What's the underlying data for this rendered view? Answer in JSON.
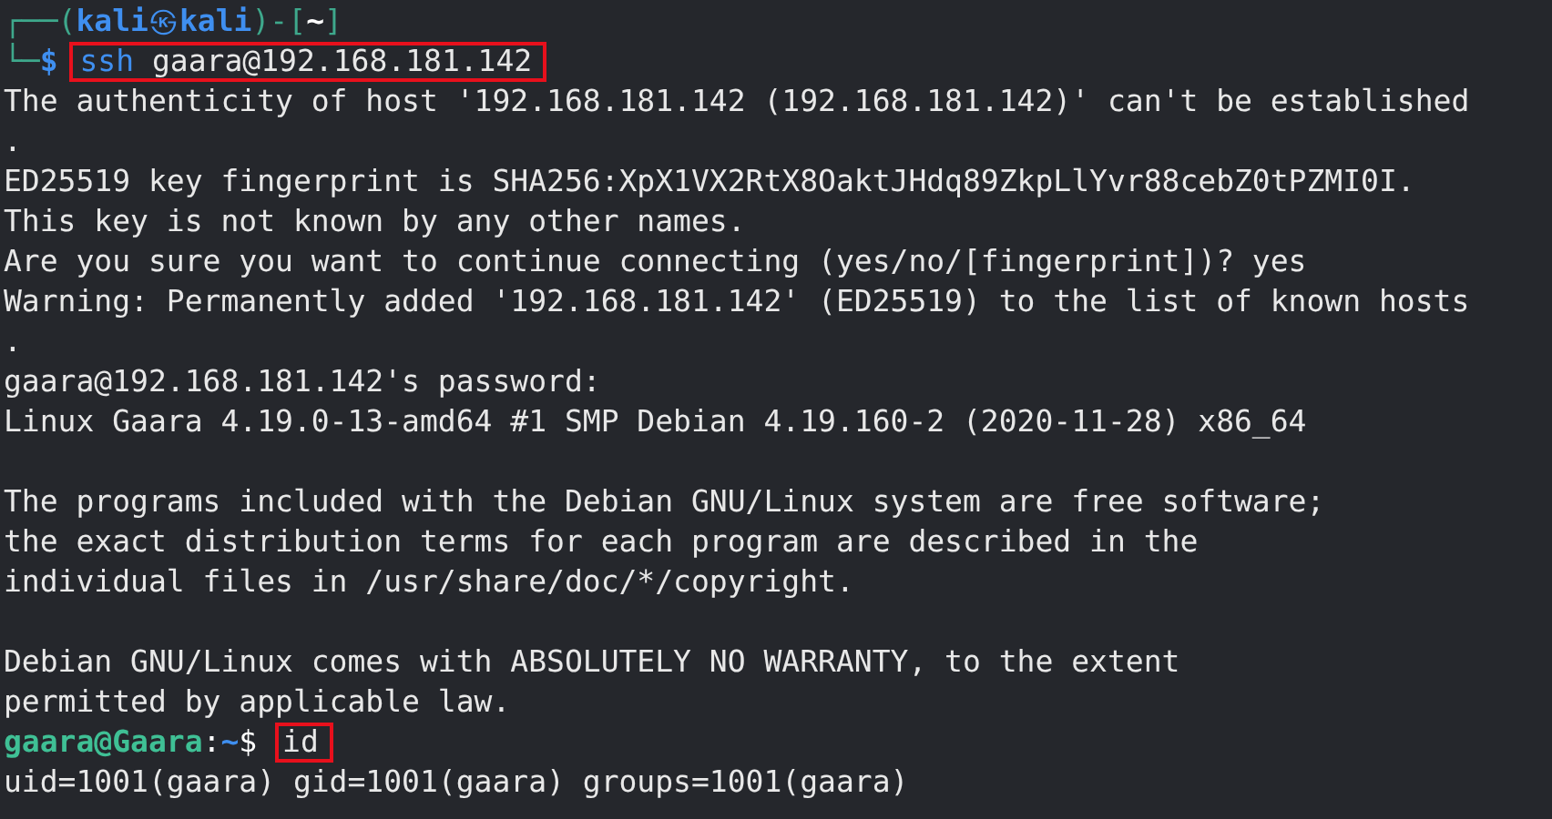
{
  "terminal": {
    "local_prompt": {
      "corner_top": "┌──(",
      "user": "kali",
      "separator": "㉿",
      "host": "kali",
      "bracket_mid": ")-[",
      "directory": "~",
      "bracket_end": "]",
      "corner_bottom": "└─",
      "symbol": "$",
      "program": "ssh",
      "args": "gaara@192.168.181.142",
      "highlighted": true
    },
    "output_blocks": [
      [
        "The authenticity of host '192.168.181.142 (192.168.181.142)' can't be established",
        ".",
        "ED25519 key fingerprint is SHA256:XpX1VX2RtX8OaktJHdq89ZkpLlYvr88cebZ0tPZMI0I.",
        "This key is not known by any other names.",
        "Are you sure you want to continue connecting (yes/no/[fingerprint])? yes",
        "Warning: Permanently added '192.168.181.142' (ED25519) to the list of known hosts",
        ".",
        "gaara@192.168.181.142's password:",
        "Linux Gaara 4.19.0-13-amd64 #1 SMP Debian 4.19.160-2 (2020-11-28) x86_64"
      ],
      [
        "The programs included with the Debian GNU/Linux system are free software;",
        "the exact distribution terms for each program are described in the",
        "individual files in /usr/share/doc/*/copyright."
      ],
      [
        "Debian GNU/Linux comes with ABSOLUTELY NO WARRANTY, to the extent",
        "permitted by applicable law."
      ]
    ],
    "remote_prompt": {
      "user_host": "gaara@Gaara",
      "colon": ":",
      "path": "~",
      "symbol": "$",
      "command": "id",
      "highlighted": true
    },
    "final_output": [
      "uid=1001(gaara) gid=1001(gaara) groups=1001(gaara)"
    ]
  }
}
